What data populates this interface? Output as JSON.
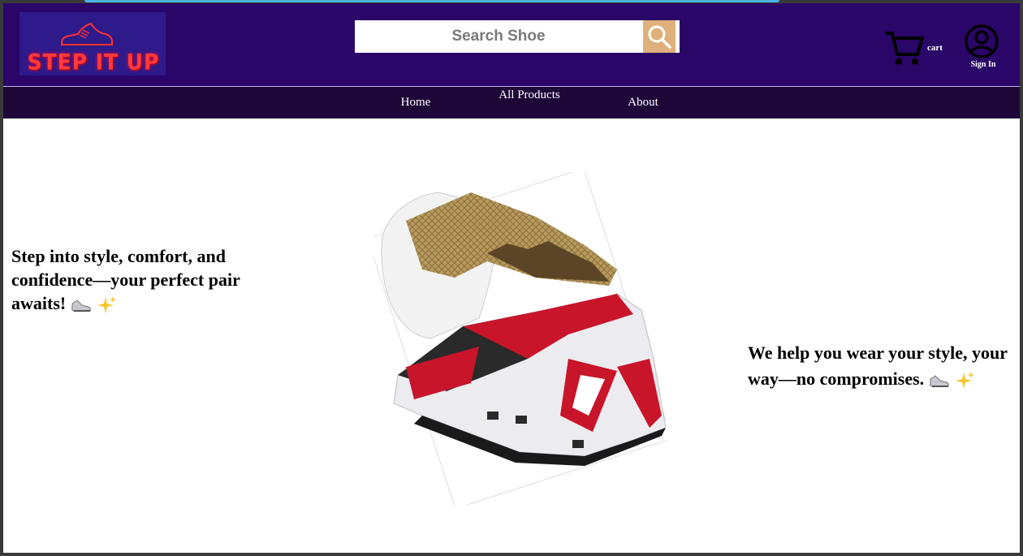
{
  "header": {
    "logo_text": "STEP IT UP",
    "search": {
      "placeholder": "Search Shoe"
    },
    "cart_label": "cart",
    "signin_label": "Sign In"
  },
  "nav": {
    "home": "Home",
    "all_products": "All Products",
    "about": "About"
  },
  "hero": {
    "left_text": "Step into style, comfort, and confidence—your perfect pair awaits!",
    "right_text": "We help you wear your style, your way—no compromises."
  },
  "colors": {
    "header_bg": "#2a0668",
    "nav_bg": "#1e0638",
    "search_button": "#e0b07c",
    "logo_text": "#ff3b3b"
  },
  "icons": [
    "shoe-logo-icon",
    "search-icon",
    "cart-icon",
    "user-icon",
    "shoe-emoji-icon",
    "sparkles-emoji-icon"
  ]
}
